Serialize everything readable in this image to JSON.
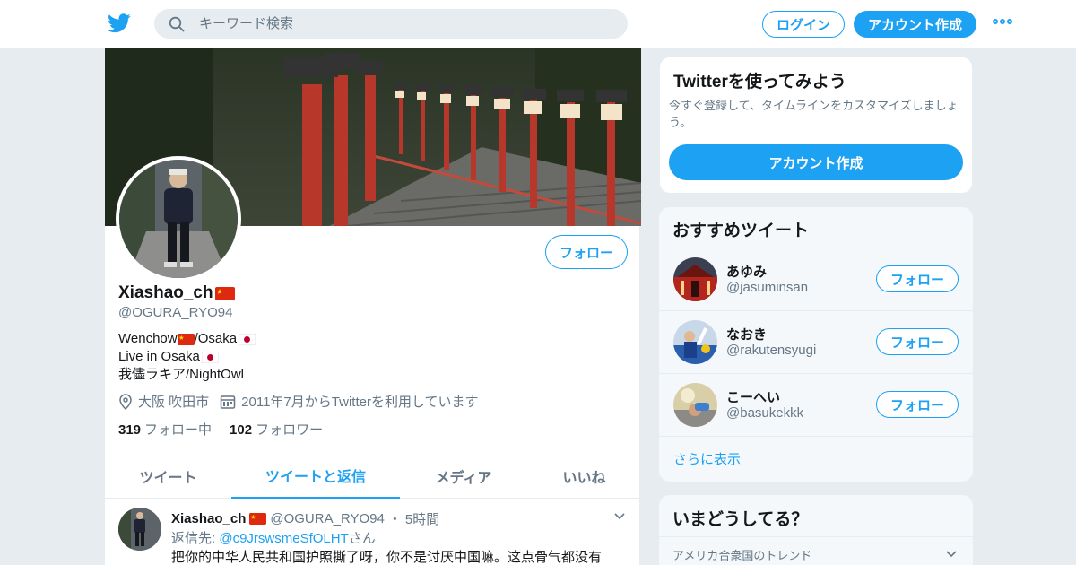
{
  "nav": {
    "search_placeholder": "キーワード検索",
    "login_label": "ログイン",
    "signup_label": "アカウント作成"
  },
  "profile": {
    "name": "Xiashao_ch",
    "handle": "@OGURA_RYO94",
    "bio_lines": [
      "Wenchow",
      "/Osaka",
      "Live in Osaka",
      "我儘ラキア/NightOwl"
    ],
    "location": "大阪 吹田市",
    "joined": "2011年7月からTwitterを利用しています",
    "following_count": "319",
    "following_label": "フォロー中",
    "followers_count": "102",
    "followers_label": "フォロワー",
    "follow_label": "フォロー"
  },
  "tabs": [
    "ツイート",
    "ツイートと返信",
    "メディア",
    "いいね"
  ],
  "tweet": {
    "name": "Xiashao_ch",
    "handle": "@OGURA_RYO94",
    "sep": "・",
    "time": "5時間",
    "reply_prefix": "返信先: ",
    "reply_to": "@c9JrswsmeSfOLHT",
    "reply_suffix": "さん",
    "text": "把你的中华人民共和国护照撕了呀，你不是讨厌中国嘛。这点骨气都没有"
  },
  "signup_card": {
    "title": "Twitterを使ってみよう",
    "description": "今すぐ登録して、タイムラインをカスタマイズしましょう。",
    "button": "アカウント作成"
  },
  "recommended": {
    "title": "おすすめツイート",
    "users": [
      {
        "name": "あゆみ",
        "handle": "@jasuminsan",
        "follow": "フォロー"
      },
      {
        "name": "なおき",
        "handle": "@rakutensyugi",
        "follow": "フォロー"
      },
      {
        "name": "こーへい",
        "handle": "@basukekkk",
        "follow": "フォロー"
      }
    ],
    "more": "さらに表示"
  },
  "trends": {
    "title": "いまどうしてる？",
    "region": "アメリカ合衆国のトレンド"
  },
  "colors": {
    "accent": "#1da1f2",
    "background": "#e6ecf0"
  }
}
